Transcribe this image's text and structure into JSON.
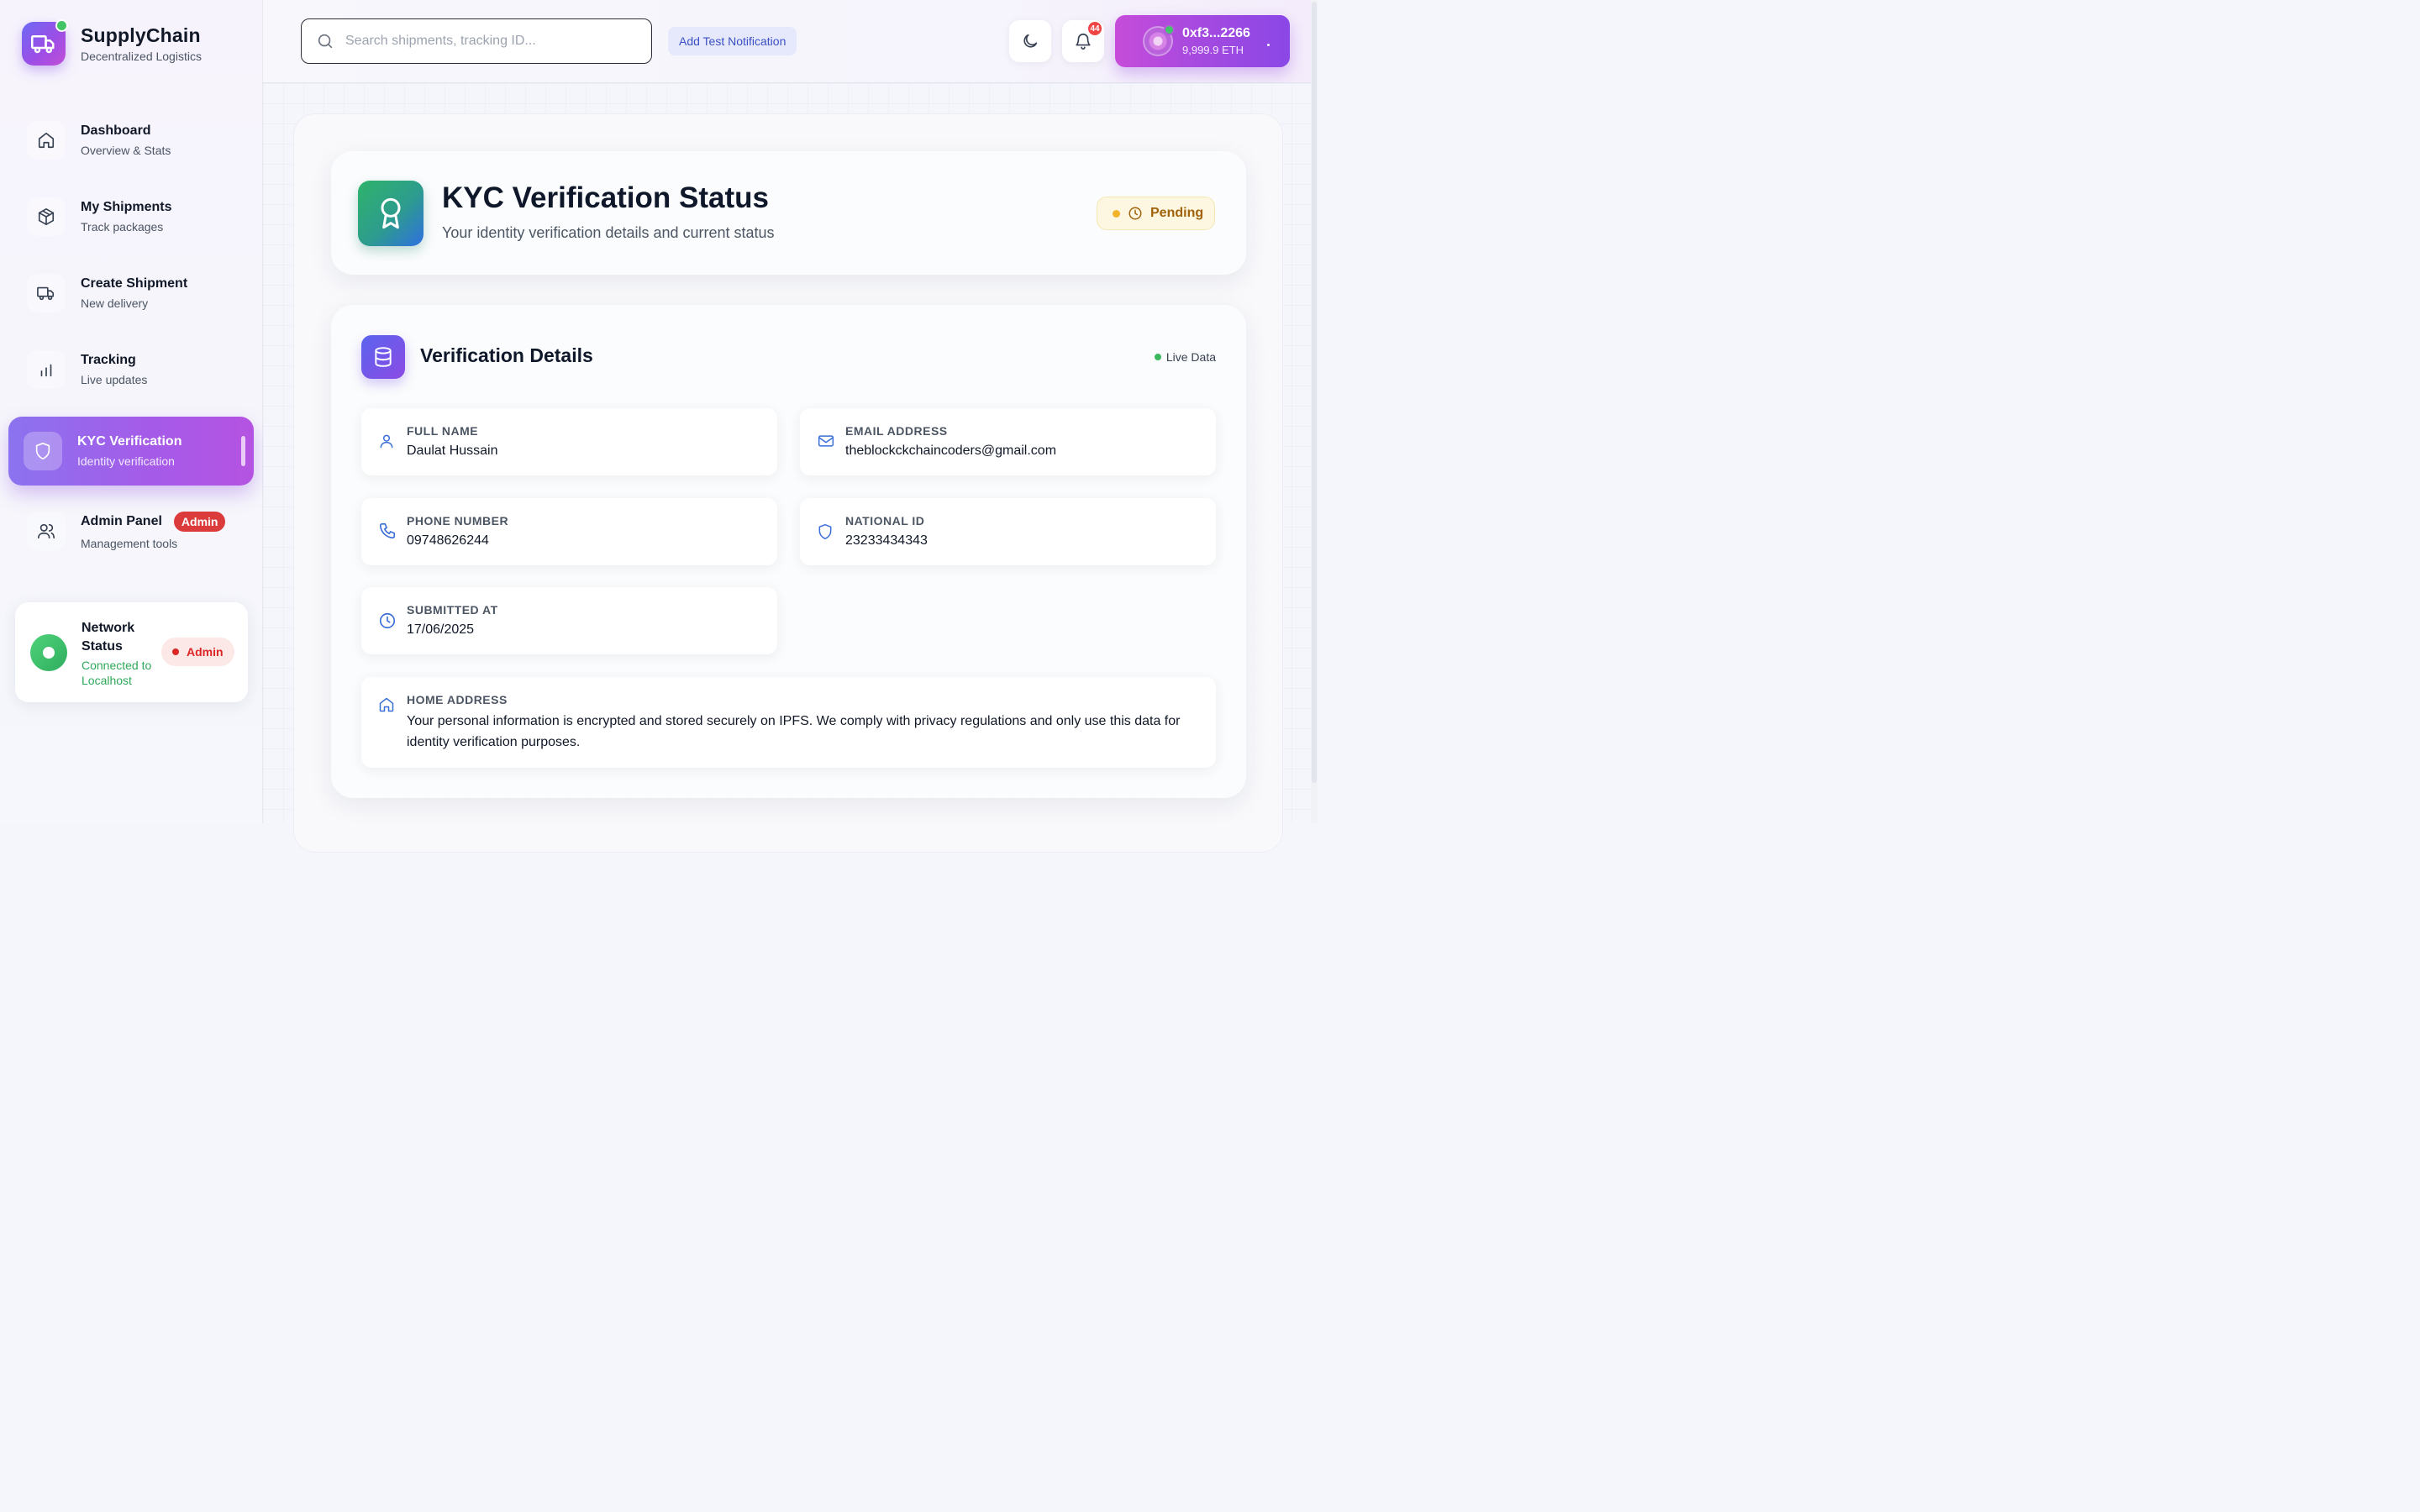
{
  "brand": {
    "name": "SupplyChain",
    "subtitle": "Decentralized Logistics",
    "logo_icon": "truck-icon"
  },
  "sidebar": {
    "items": [
      {
        "label": "Dashboard",
        "sub": "Overview & Stats",
        "icon": "home-icon"
      },
      {
        "label": "My Shipments",
        "sub": "Track packages",
        "icon": "package-icon"
      },
      {
        "label": "Create Shipment",
        "sub": "New delivery",
        "icon": "truck-icon"
      },
      {
        "label": "Tracking",
        "sub": "Live updates",
        "icon": "bar-chart-icon"
      },
      {
        "label": "KYC Verification",
        "sub": "Identity verification",
        "icon": "shield-icon",
        "active": true
      },
      {
        "label": "Admin Panel",
        "sub": "Management tools",
        "icon": "users-icon",
        "badge": "Admin"
      }
    ],
    "network": {
      "title": "Network Status",
      "status": "Connected to Localhost",
      "badge": "Admin"
    }
  },
  "topbar": {
    "search_placeholder": "Search shipments, tracking ID...",
    "test_notification_label": "Add Test Notification",
    "theme_icon": "moon-icon",
    "notification_icon": "bell-icon",
    "notification_count": "44",
    "wallet": {
      "address": "0xf3...2266",
      "balance": "9,999.9 ETH"
    }
  },
  "kyc": {
    "title": "KYC Verification Status",
    "subtitle": "Your identity verification details and current status",
    "status": "Pending",
    "status_color": "#a0620b"
  },
  "details": {
    "title": "Verification Details",
    "live_label": "Live Data",
    "fields": {
      "full_name": {
        "label": "Full Name",
        "value": "Daulat Hussain"
      },
      "email": {
        "label": "Email Address",
        "value": "theblockckchaincoders@gmail.com"
      },
      "phone": {
        "label": "Phone Number",
        "value": "09748626244"
      },
      "national_id": {
        "label": "National ID",
        "value": "23233434343"
      },
      "submitted_at": {
        "label": "Submitted At",
        "value": "17/06/2025"
      },
      "home_address": {
        "label": "Home Address",
        "value": "Your personal information is encrypted and stored securely on IPFS. We comply with privacy regulations and only use this data for identity verification purposes."
      }
    }
  },
  "colors": {
    "accent_purple": "#9b4ee6",
    "success_green": "#3bb85f",
    "danger_red": "#dc2626",
    "field_icon_blue": "#3b6fd8"
  }
}
